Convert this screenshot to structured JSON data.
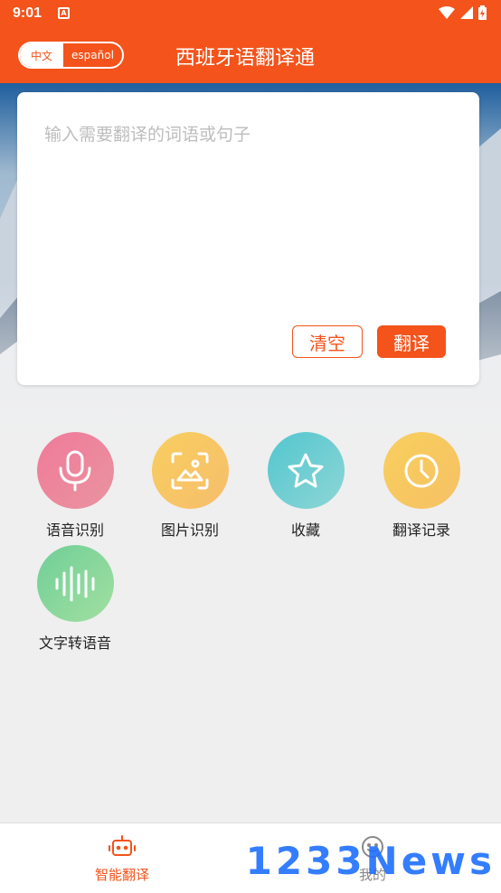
{
  "status": {
    "time": "9:01",
    "notification_glyph": "A"
  },
  "header": {
    "lang_zh": "中文",
    "lang_es": "español",
    "title": "西班牙语翻译通"
  },
  "input": {
    "placeholder": "输入需要翻译的词语或句子"
  },
  "actions": {
    "clear": "清空",
    "translate": "翻译"
  },
  "features": [
    {
      "label": "语音识别",
      "icon": "microphone-icon",
      "color": "#ef7f9f"
    },
    {
      "label": "图片识别",
      "icon": "image-scan-icon",
      "color": "#f7c75c"
    },
    {
      "label": "收藏",
      "icon": "star-icon",
      "color": "#5cc8cf"
    },
    {
      "label": "翻译记录",
      "icon": "clock-icon",
      "color": "#f7c75c"
    },
    {
      "label": "文字转语音",
      "icon": "sound-wave-icon",
      "color": "#7fd59b"
    }
  ],
  "bottom_nav": [
    {
      "label": "智能翻译",
      "icon": "robot-icon",
      "active": true
    },
    {
      "label": "我的",
      "icon": "smiley-icon",
      "active": false
    }
  ],
  "watermark": "1233News",
  "colors": {
    "accent": "#f4531b",
    "background": "#efefef"
  }
}
